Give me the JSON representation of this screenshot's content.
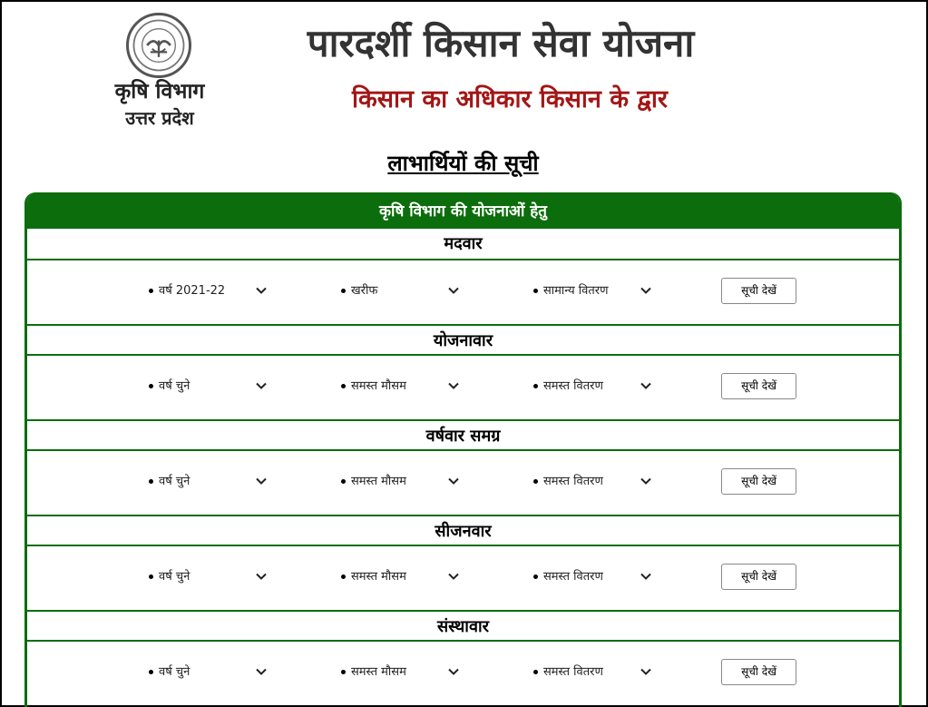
{
  "header": {
    "department": "कृषि विभाग",
    "state": "उत्तर प्रदेश",
    "title": "पारदर्शी किसान सेवा योजना",
    "tagline": "किसान का अधिकार किसान के द्वार",
    "emblem_text": "उत्तर प्रदेश सरकार"
  },
  "list_title": "लाभार्थियों की सूची",
  "panel": {
    "header": "कृषि विभाग की योजनाओं हेतु",
    "accent_color": "#0c6d0c",
    "sections": [
      {
        "title": "मदवार",
        "year": "वर्ष 2021-22",
        "season": "खरीफ",
        "distribution": "सामान्य वितरण",
        "button": "सूची देखें"
      },
      {
        "title": "योजनावार",
        "year": "वर्ष चुने",
        "season": "समस्त मौसम",
        "distribution": "समस्त वितरण",
        "button": "सूची देखें"
      },
      {
        "title": "वर्षवार समग्र",
        "year": "वर्ष चुने",
        "season": "समस्त मौसम",
        "distribution": "समस्त वितरण",
        "button": "सूची देखें"
      },
      {
        "title": "सीजनवार",
        "year": "वर्ष चुने",
        "season": "समस्त मौसम",
        "distribution": "समस्त वितरण",
        "button": "सूची देखें"
      },
      {
        "title": "संस्थावार",
        "year": "वर्ष चुने",
        "season": "समस्त मौसम",
        "distribution": "समस्त वितरण",
        "button": "सूची देखें"
      }
    ]
  },
  "icons": {
    "emblem": "up-government-emblem-icon",
    "chevron": "chevron-down-icon"
  }
}
